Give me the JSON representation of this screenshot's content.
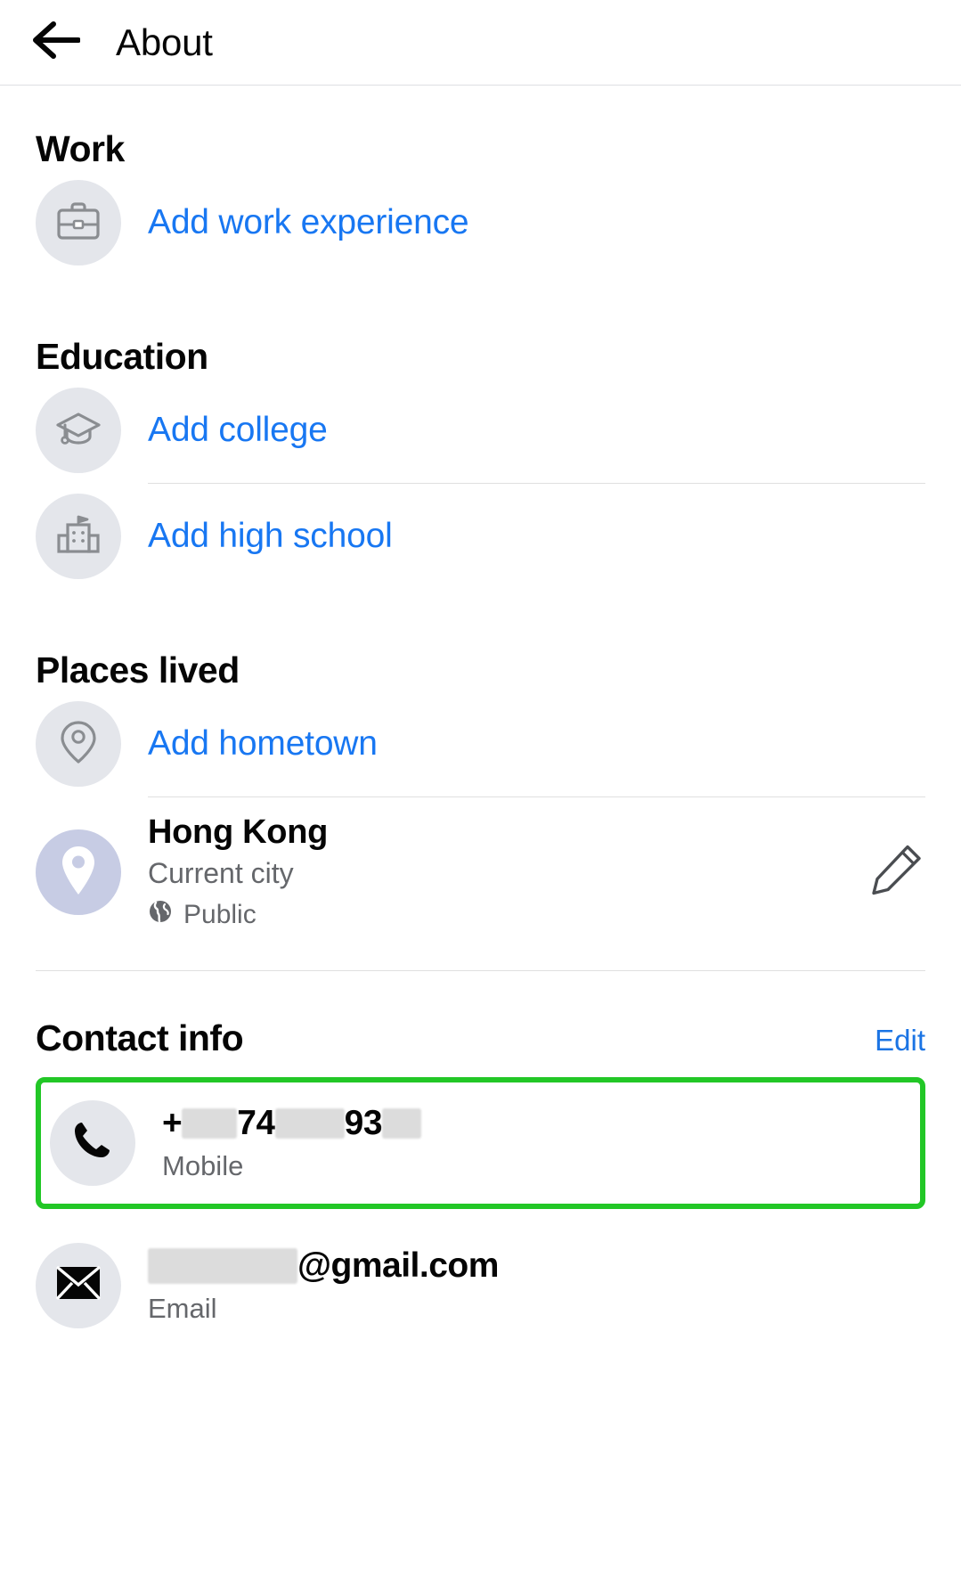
{
  "header": {
    "back_icon": "arrow-left-icon",
    "title": "About"
  },
  "sections": {
    "work": {
      "title": "Work",
      "items": [
        {
          "icon": "briefcase-icon",
          "label": "Add work experience"
        }
      ]
    },
    "education": {
      "title": "Education",
      "items": [
        {
          "icon": "graduation-cap-icon",
          "label": "Add college"
        },
        {
          "icon": "school-building-icon",
          "label": "Add high school"
        }
      ]
    },
    "places_lived": {
      "title": "Places lived",
      "add_label": "Add hometown",
      "add_icon": "location-pin-outline-icon",
      "entry": {
        "icon": "location-pin-filled-icon",
        "name": "Hong Kong",
        "subtitle": "Current city",
        "privacy": "Public",
        "privacy_icon": "globe-icon",
        "edit_icon": "pencil-icon"
      }
    },
    "contact_info": {
      "title": "Contact info",
      "edit_label": "Edit",
      "phone": {
        "icon": "phone-icon",
        "prefix": "+",
        "digits_visible_1": "74",
        "digits_visible_2": "93",
        "label": "Mobile",
        "redacted": true
      },
      "email": {
        "icon": "envelope-icon",
        "domain": "@gmail.com",
        "label": "Email",
        "redacted": true
      }
    }
  },
  "colors": {
    "link_blue": "#1877f2",
    "action_blue": "#1b74e4",
    "icon_bg": "#e4e6eb",
    "lavender_bg": "#c7cce4",
    "highlight_green": "#22c726",
    "secondary_text": "#65676b"
  }
}
